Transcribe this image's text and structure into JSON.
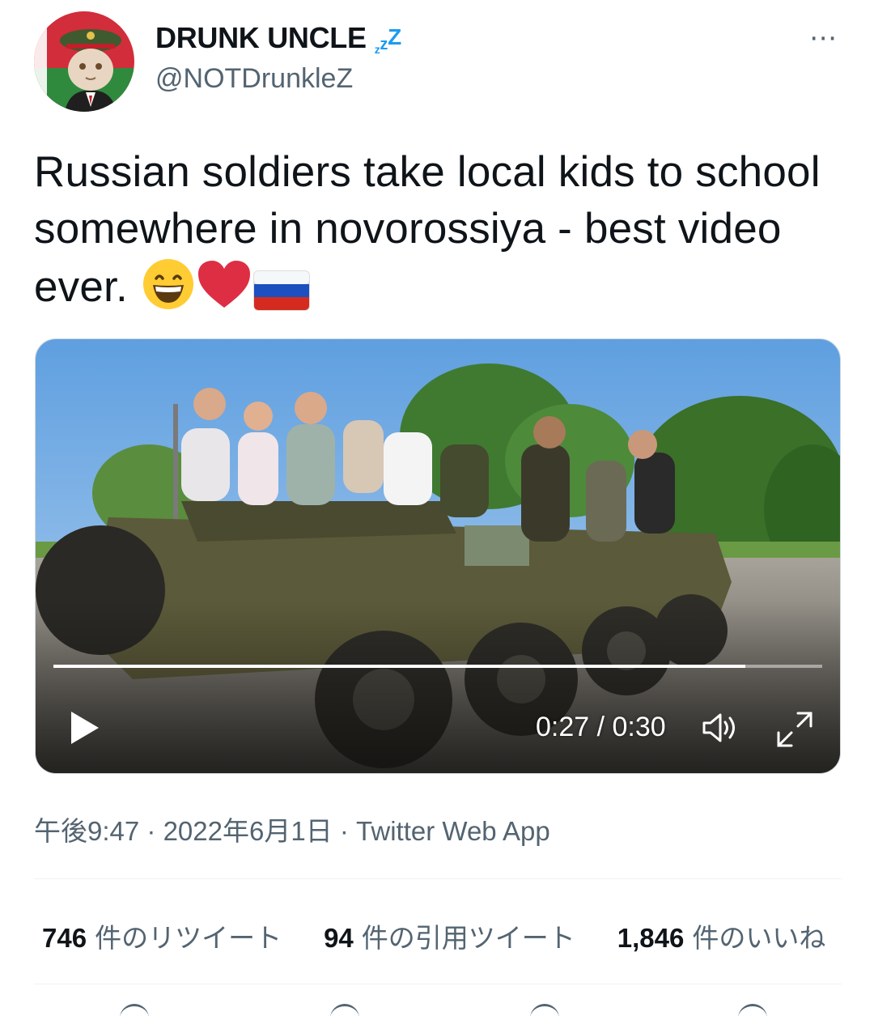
{
  "author": {
    "display_name": "DRUNK UNCLE",
    "name_badge": [
      "z",
      "z",
      "Z"
    ],
    "handle": "@NOTDrunkleZ",
    "avatar_icon": "cat-general-avatar-icon"
  },
  "more_icon": "⋯",
  "tweet": {
    "text": "Russian soldiers take local kids to school somewhere in novorossiya - best video ever.",
    "emojis": [
      "grinning-face-icon",
      "red-heart-icon",
      "russia-flag-icon"
    ]
  },
  "video": {
    "current_time": "0:27",
    "duration": "0:30",
    "time_label": "0:27 / 0:30",
    "progress": 0.9,
    "icons": [
      "play-icon",
      "volume-icon",
      "fullscreen-icon"
    ]
  },
  "meta": {
    "time": "午後9:47",
    "date": "2022年6月1日",
    "source": "Twitter Web App",
    "separator": "·"
  },
  "stats": [
    {
      "count": "746",
      "label": "件のリツイート"
    },
    {
      "count": "94",
      "label": "件の引用ツイート"
    },
    {
      "count": "1,846",
      "label": "件のいいね"
    }
  ],
  "colors": {
    "accent": "#1d9bf0",
    "text": "#0f1419",
    "secondary": "#536471",
    "divider": "#eff3f4"
  }
}
